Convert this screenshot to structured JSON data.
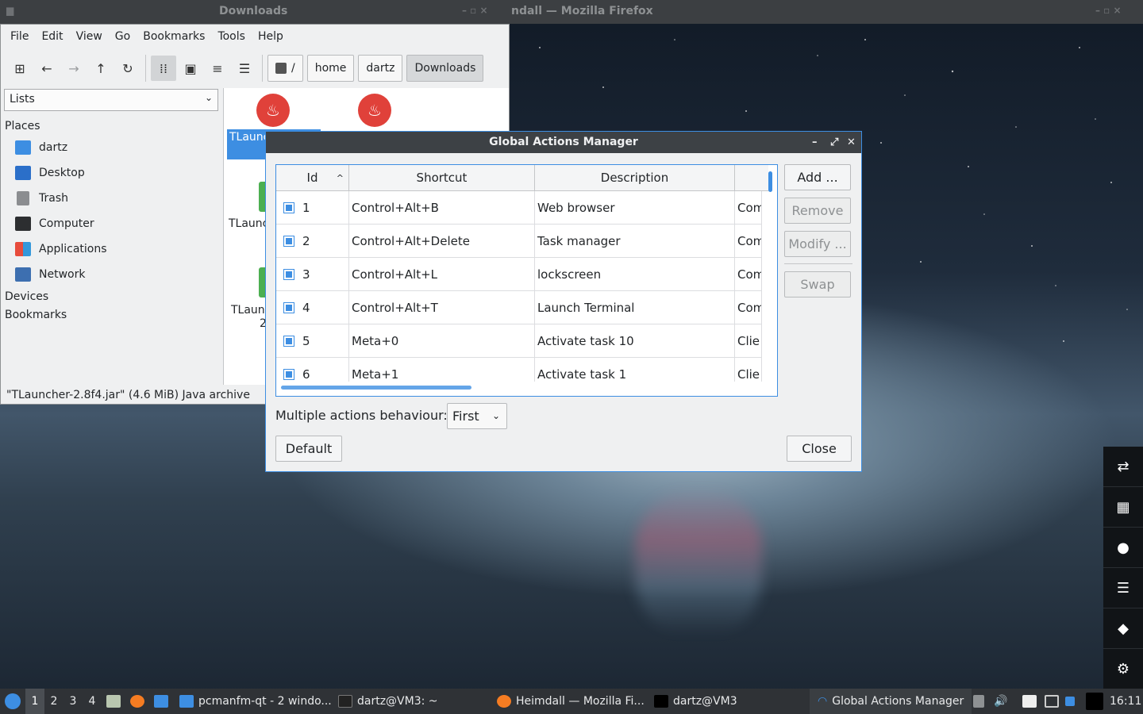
{
  "titlestrip": {
    "fm_title": "Downloads",
    "ff_title": "ndall — Mozilla Firefox"
  },
  "filemanager": {
    "menu": [
      "File",
      "Edit",
      "View",
      "Go",
      "Bookmarks",
      "Tools",
      "Help"
    ],
    "breadcrumb": [
      "/",
      "home",
      "dartz",
      "Downloads"
    ],
    "side_combo": "Lists",
    "places_heading": "Places",
    "places": [
      "dartz",
      "Desktop",
      "Trash",
      "Computer",
      "Applications",
      "Network"
    ],
    "devices_heading": "Devices",
    "bookmarks_heading": "Bookmarks",
    "items": [
      "TLaunc",
      "TLaunc",
      "TLaunc",
      "2"
    ],
    "status": "\"TLauncher-2.8f4.jar\" (4.6 MiB) Java archive"
  },
  "dialog": {
    "title": "Global Actions Manager",
    "columns": [
      "Id",
      "Shortcut",
      "Description"
    ],
    "rows": [
      {
        "id": "1",
        "shortcut": "Control+Alt+B",
        "description": "Web browser",
        "type": "Com"
      },
      {
        "id": "2",
        "shortcut": "Control+Alt+Delete",
        "description": "Task manager",
        "type": "Com"
      },
      {
        "id": "3",
        "shortcut": "Control+Alt+L",
        "description": "lockscreen",
        "type": "Com"
      },
      {
        "id": "4",
        "shortcut": "Control+Alt+T",
        "description": "Launch Terminal",
        "type": "Com"
      },
      {
        "id": "5",
        "shortcut": "Meta+0",
        "description": "Activate task 10",
        "type": "Clie"
      },
      {
        "id": "6",
        "shortcut": "Meta+1",
        "description": "Activate task 1",
        "type": "Clie"
      }
    ],
    "buttons": {
      "add": "Add ...",
      "remove": "Remove",
      "modify": "Modify ...",
      "swap": "Swap",
      "default": "Default",
      "close": "Close"
    },
    "behaviour_label": "Multiple actions behaviour:",
    "behaviour_value": "First"
  },
  "taskbar": {
    "workspaces": [
      "1",
      "2",
      "3",
      "4"
    ],
    "tasks": [
      "pcmanfm-qt - 2 windo...",
      "dartz@VM3: ~",
      "Heimdall — Mozilla Fi...",
      "dartz@VM3",
      "Global Actions Manager"
    ],
    "clock": "16:11"
  },
  "colors": {
    "accent": "#3d8ee2",
    "title_dark": "#3d4145",
    "taskbar": "#2f3236",
    "java_red": "#e0413a"
  }
}
